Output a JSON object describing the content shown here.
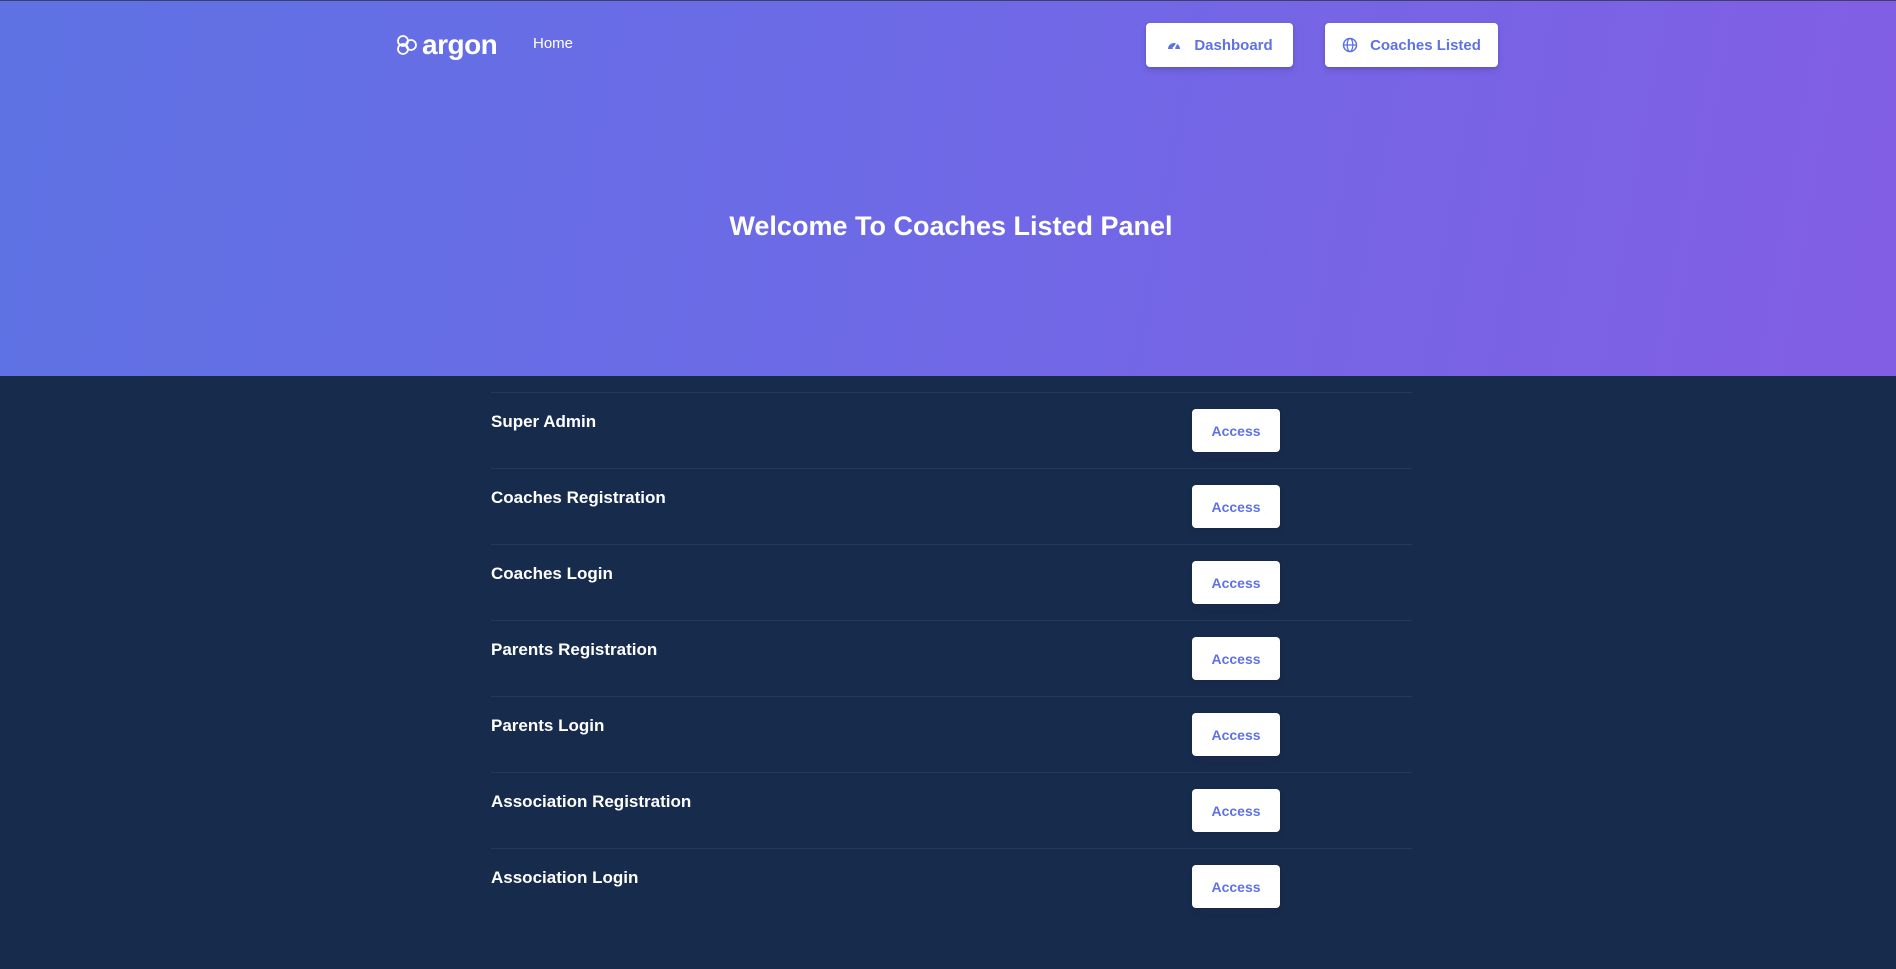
{
  "brand": {
    "name": "argon",
    "logo_icon": "argon-logo-icon"
  },
  "nav": {
    "home_label": "Home",
    "dashboard_label": "Dashboard",
    "dashboard_icon": "dashboard-gauge-icon",
    "coaches_label": "Coaches Listed",
    "coaches_icon": "globe-icon"
  },
  "hero": {
    "title": "Welcome To Coaches Listed Panel"
  },
  "colors": {
    "gradient_start": "#5e72e4",
    "gradient_end": "#825ee4",
    "background": "#172b4d",
    "accent": "#5e72e4"
  },
  "panels": [
    {
      "label": "Super Admin",
      "button": "Access"
    },
    {
      "label": "Coaches Registration",
      "button": "Access"
    },
    {
      "label": "Coaches Login",
      "button": "Access"
    },
    {
      "label": "Parents Registration",
      "button": "Access"
    },
    {
      "label": "Parents Login",
      "button": "Access"
    },
    {
      "label": "Association Registration",
      "button": "Access"
    },
    {
      "label": "Association Login",
      "button": "Access"
    }
  ]
}
